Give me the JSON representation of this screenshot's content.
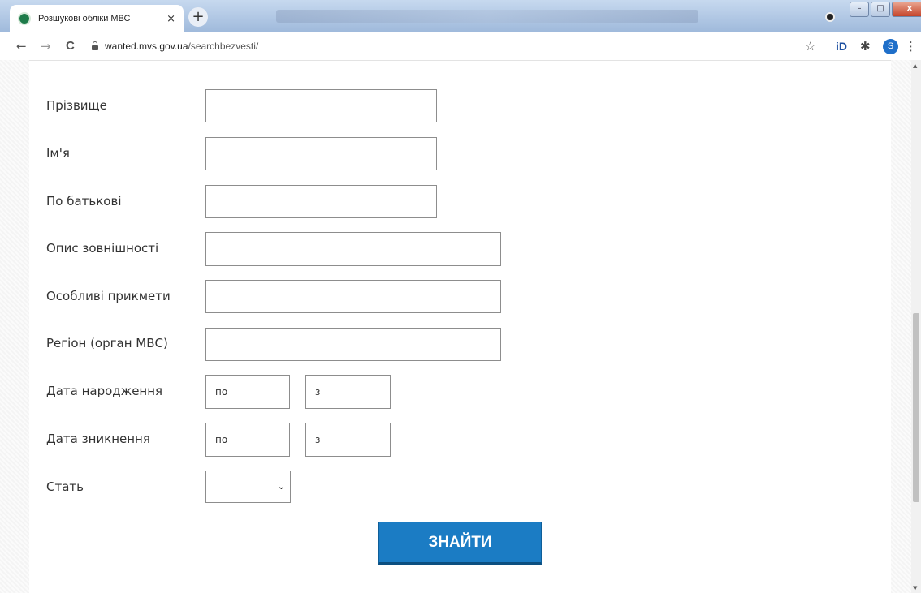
{
  "browser": {
    "tab_title": "Розшукові обліки МВС",
    "tab_close": "×",
    "new_tab": "+",
    "url_domain": "wanted.mvs.gov.ua",
    "url_path": "/searchbezvesti/",
    "back": "←",
    "forward": "→",
    "reload": "C",
    "star": "☆",
    "extension_id": "iD",
    "extensions": "✱",
    "profile_initial": "S",
    "menu": "⋮",
    "window_minimize": "–",
    "window_maximize": "□",
    "window_close": "x"
  },
  "form": {
    "fields": [
      {
        "label": "Прізвище"
      },
      {
        "label": "Ім'я"
      },
      {
        "label": "По батькові"
      },
      {
        "label": "Опис зовнішності"
      },
      {
        "label": "Особливі прикмети"
      },
      {
        "label": "Регіон (орган МВС)"
      }
    ],
    "birth_date": {
      "label": "Дата народження",
      "from": "по",
      "to": "з"
    },
    "disappearance_date": {
      "label": "Дата зникнення",
      "from": "по",
      "to": "з"
    },
    "sex": {
      "label": "Стать",
      "value": ""
    },
    "submit_label": "ЗНАЙТИ"
  }
}
